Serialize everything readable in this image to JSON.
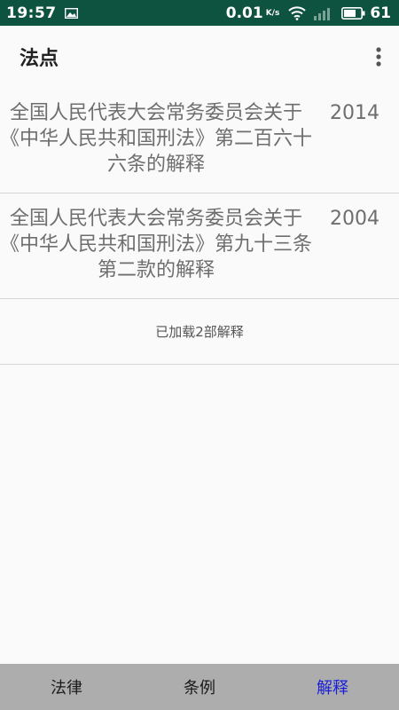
{
  "status_bar": {
    "time": "19:57",
    "net_speed": "0.01",
    "net_unit": "K/s",
    "battery": "61"
  },
  "app_bar": {
    "title": "法点"
  },
  "list": {
    "items": [
      {
        "title": "全国人民代表大会常务委员会关于《中华人民共和国刑法》第二百六十六条的解释",
        "year": "2014"
      },
      {
        "title": "全国人民代表大会常务委员会关于《中华人民共和国刑法》第九十三条第二款的解释",
        "year": "2004"
      }
    ],
    "footer": "已加载2部解释"
  },
  "bottom_nav": {
    "tabs": [
      {
        "label": "法律"
      },
      {
        "label": "条例"
      },
      {
        "label": "解释"
      }
    ],
    "active_index": 2
  },
  "colors": {
    "status_bar": "#0e5340",
    "active_tab": "#1a20d8",
    "bottom_nav_bg": "#adadad"
  }
}
